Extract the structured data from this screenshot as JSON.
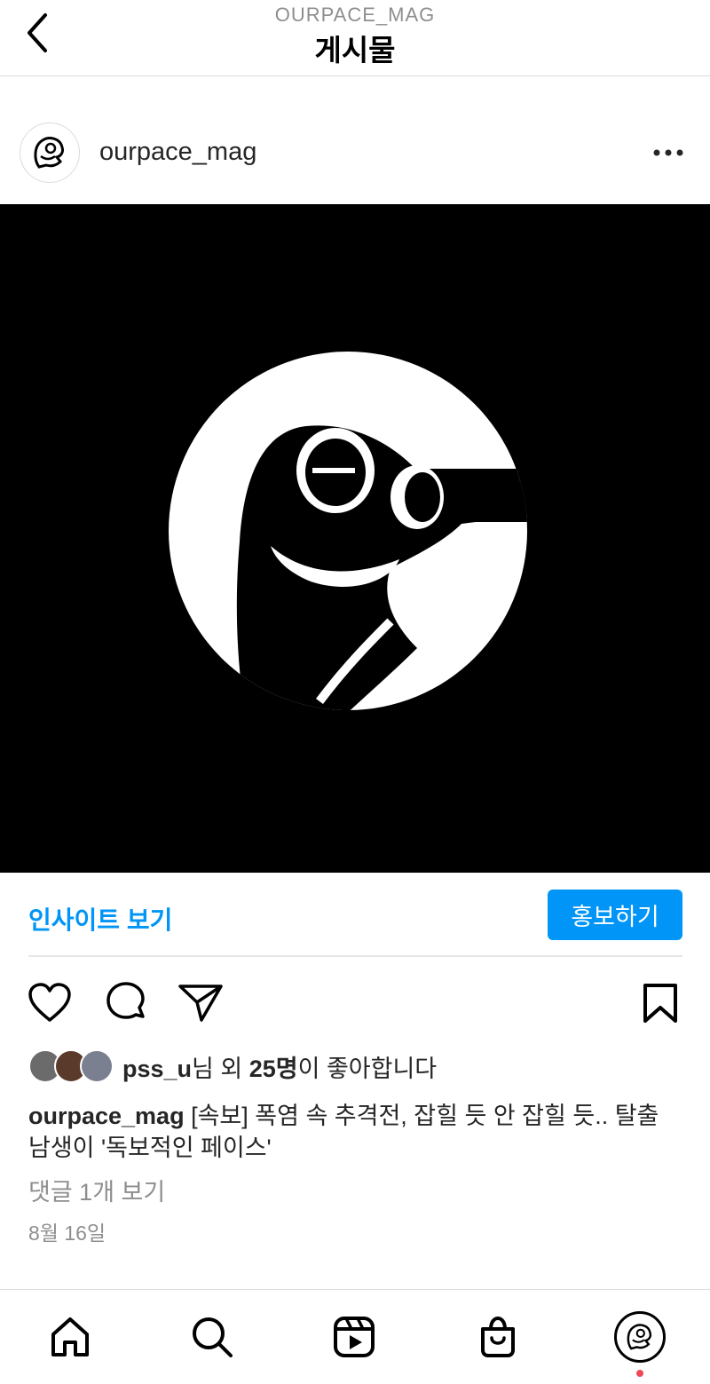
{
  "header": {
    "subtitle": "OURPACE_MAG",
    "title": "게시물"
  },
  "post": {
    "username": "ourpace_mag",
    "insights_label": "인사이트 보기",
    "promote_label": "홍보하기",
    "likes": {
      "user": "pss_u",
      "middle": "님 외 ",
      "count": "25명",
      "suffix": "이 좋아합니다"
    },
    "caption": {
      "username": "ourpace_mag",
      "text": " [속보] 폭염 속 추격전, 잡힐 듯 안 잡힐 듯.. 탈출 남생이 '독보적인 페이스'"
    },
    "comments_link": "댓글 1개 보기",
    "date": "8월 16일"
  },
  "icons": {
    "back": "chevron-left-icon",
    "more": "more-horizontal-icon",
    "like": "heart-icon",
    "comment": "comment-icon",
    "share": "send-icon",
    "save": "bookmark-icon",
    "home": "home-icon",
    "search": "search-icon",
    "reels": "reels-icon",
    "shop": "shopping-bag-icon"
  },
  "colors": {
    "accent": "#0095f6",
    "notification": "#ed4956"
  }
}
